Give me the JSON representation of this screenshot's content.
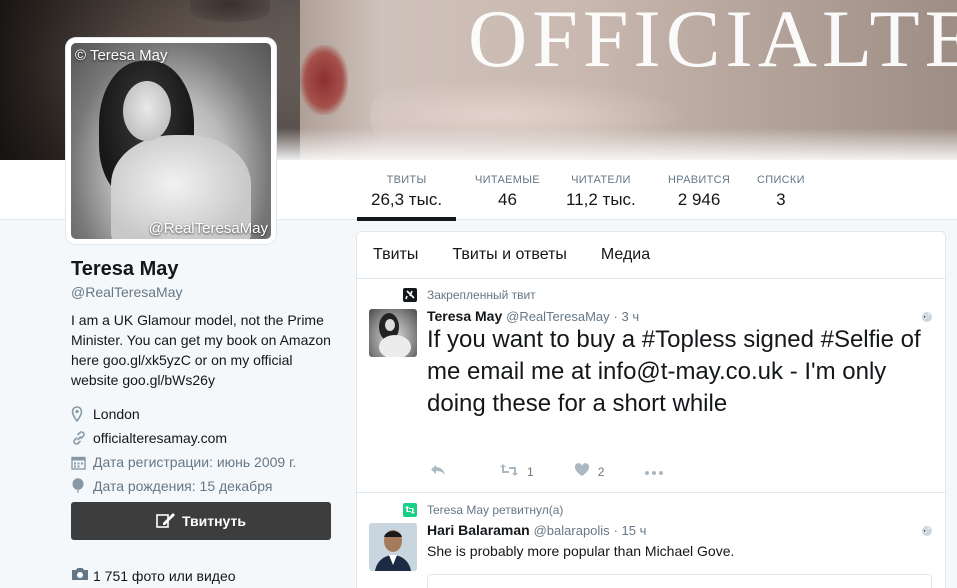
{
  "banner": {
    "text": "OFFICIALTER"
  },
  "avatar": {
    "copyright": "© Teresa May",
    "watermark": "@RealTeresaMay"
  },
  "stats": [
    {
      "label": "ТВИТЫ",
      "value": "26,3 тыс.",
      "active": true
    },
    {
      "label": "ЧИТАЕМЫЕ",
      "value": "46"
    },
    {
      "label": "ЧИТАТЕЛИ",
      "value": "11,2 тыс."
    },
    {
      "label": "НРАВИТСЯ",
      "value": "2 946"
    },
    {
      "label": "СПИСКИ",
      "value": "3"
    }
  ],
  "profile": {
    "name": "Teresa May",
    "handle": "@RealTeresaMay",
    "bio": "I am a UK Glamour model, not the Prime Minister. You can get my book on Amazon here goo.gl/xk5yzC or on my official website goo.gl/bWs26y",
    "location": "London",
    "website": "officialteresamay.com",
    "joined": "Дата регистрации: июнь 2009 г.",
    "birthday": "Дата рождения: 15 декабря",
    "tweet_button": "Твитнуть",
    "media_count": "1 751 фото или видео"
  },
  "timeline": {
    "tabs": [
      "Твиты",
      "Твиты и ответы",
      "Медиа"
    ],
    "tweets": [
      {
        "context": "Закрепленный твит",
        "name": "Teresa May",
        "handle": "@RealTeresaMay",
        "time": "· 3 ч",
        "text_parts": [
          "If you want to buy a ",
          "#Topless",
          " signed ",
          "#Selfie",
          " of me email me at  info@t-may.co.uk - I'm only doing these for a short while"
        ],
        "retweets": "1",
        "likes": "2"
      },
      {
        "context": "Teresa May ретвитнул(а)",
        "name": "Hari Balaraman",
        "handle": "@balarapolis",
        "time": "· 15 ч",
        "text": "She is probably more popular than Michael Gove."
      }
    ]
  },
  "colors": {
    "accent_dark": "#14171a",
    "muted": "#657786",
    "button_bg": "#3d3d3d",
    "retweet_green": "#19cf86"
  }
}
